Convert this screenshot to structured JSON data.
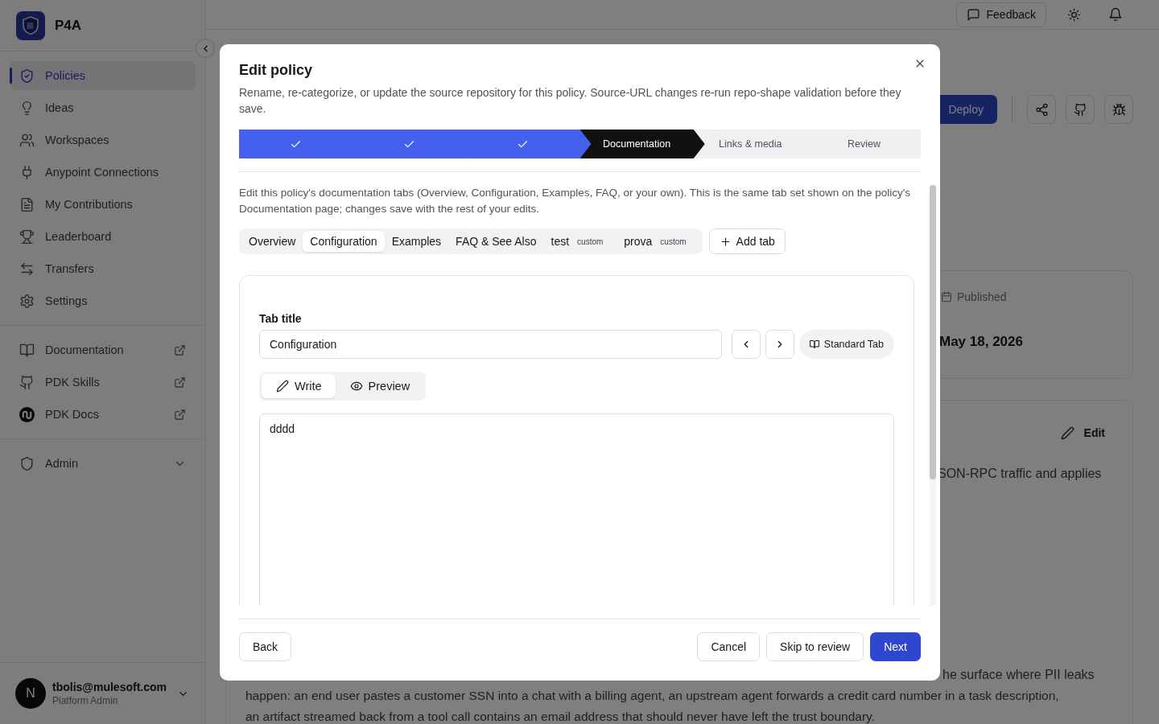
{
  "app": {
    "name": "P4A"
  },
  "sidebar": {
    "nav": [
      {
        "label": "Policies",
        "selected": true
      },
      {
        "label": "Ideas",
        "selected": false
      },
      {
        "label": "Workspaces",
        "selected": false
      },
      {
        "label": "Anypoint Connections",
        "selected": false
      },
      {
        "label": "My Contributions",
        "selected": false
      },
      {
        "label": "Leaderboard",
        "selected": false
      },
      {
        "label": "Transfers",
        "selected": false
      },
      {
        "label": "Settings",
        "selected": false
      }
    ],
    "links": [
      {
        "label": "Documentation"
      },
      {
        "label": "PDK Skills"
      },
      {
        "label": "PDK Docs"
      }
    ],
    "admin": {
      "label": "Admin",
      "expanded": false
    },
    "user": {
      "initial": "N",
      "email": "tbolis@mulesoft.com",
      "role": "Platform Admin"
    }
  },
  "header": {
    "feedback": "Feedback"
  },
  "page": {
    "deploy": "Deploy",
    "published_label": "Published",
    "published_date": "May 18, 2026",
    "edit": "Edit",
    "description_lines": [
      "SON-RPC traffic and applies",
      "he surface where PII leaks",
      "happen: an end user pastes a customer SSN into a chat with a billing agent, an upstream agent forwards a credit card number in a task description,",
      "an artifact streamed back from a tool call contains an email address that should never have left the trust boundary."
    ]
  },
  "modal": {
    "title": "Edit policy",
    "description": "Rename, re-categorize, or update the source repository for this policy. Source-URL changes re-run repo-shape validation before they save.",
    "steps": [
      {
        "done": true
      },
      {
        "done": true
      },
      {
        "done": true
      },
      {
        "label": "Documentation",
        "done": false,
        "current": true
      },
      {
        "label": "Links & media",
        "done": false,
        "current": false
      },
      {
        "label": "Review",
        "done": false,
        "current": false
      }
    ],
    "intro": "Edit this policy's documentation tabs (Overview, Configuration, Examples, FAQ, or your own). This is the same tab set shown on the policy's Documentation page; changes save with the rest of your edits.",
    "tabs": [
      {
        "label": "Overview",
        "selected": false
      },
      {
        "label": "Configuration",
        "selected": true
      },
      {
        "label": "Examples",
        "selected": false
      },
      {
        "label": "FAQ & See Also",
        "selected": false
      },
      {
        "label": "test",
        "badge": "custom",
        "selected": false
      },
      {
        "label": "prova",
        "badge": "custom",
        "selected": false
      }
    ],
    "add_tab": "Add tab",
    "tab_title_label": "Tab title",
    "tab_title_value": "Configuration",
    "standard_tab": "Standard Tab",
    "editor_modes": [
      {
        "label": "Write",
        "selected": true
      },
      {
        "label": "Preview",
        "selected": false
      }
    ],
    "content": "dddd",
    "footer": {
      "back": "Back",
      "cancel": "Cancel",
      "skip": "Skip to review",
      "next": "Next"
    }
  }
}
